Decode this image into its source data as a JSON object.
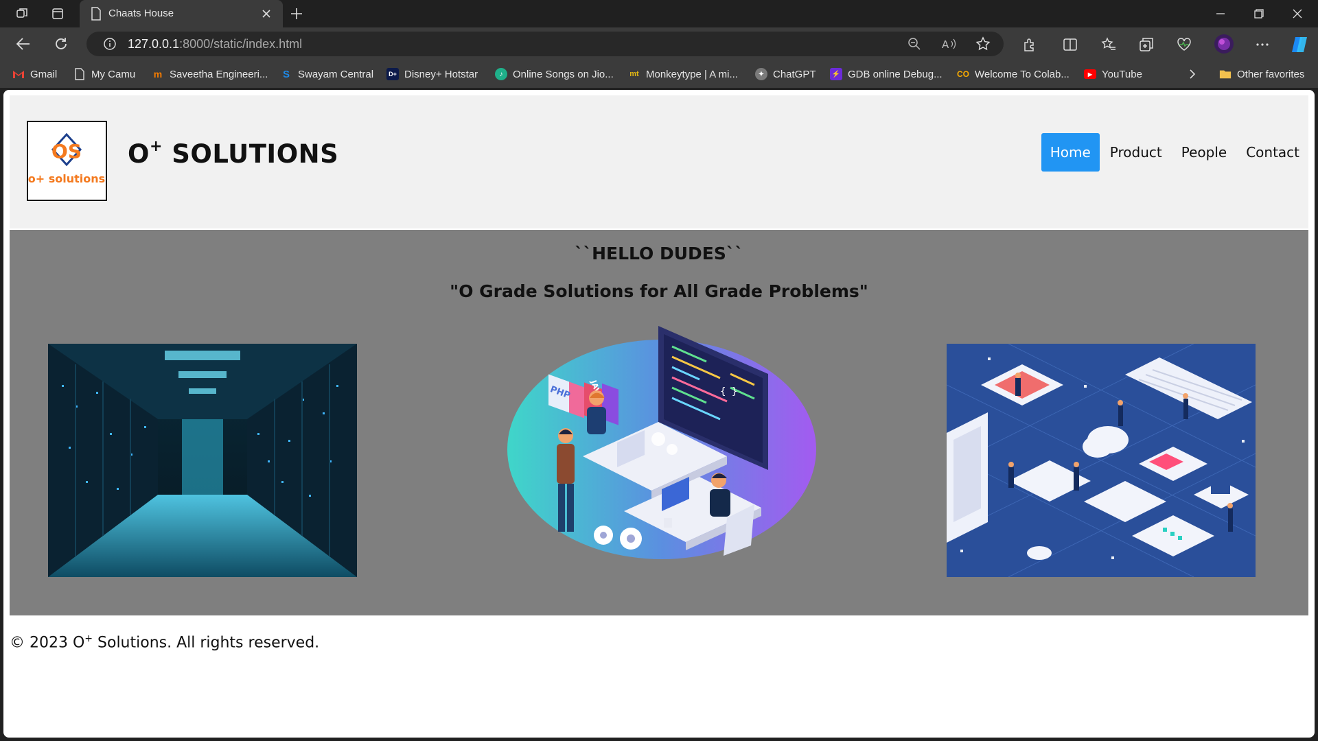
{
  "browser": {
    "tab_title": "Chaats House",
    "url_host": "127.0.0.1",
    "url_rest": ":8000/static/index.html",
    "bookmarks": [
      {
        "label": "Gmail",
        "icon": "gmail-icon",
        "color": "#ea4335"
      },
      {
        "label": "My Camu",
        "icon": "page-icon",
        "color": "#3b3b3b"
      },
      {
        "label": "Saveetha Engineeri...",
        "icon": "saveetha-icon",
        "color": "#f57c00"
      },
      {
        "label": "Swayam Central",
        "icon": "swayam-icon",
        "color": "#1e88e5"
      },
      {
        "label": "Disney+ Hotstar",
        "icon": "hotstar-icon",
        "color": "#0c1a4a"
      },
      {
        "label": "Online Songs on Jio...",
        "icon": "jiosaavn-icon",
        "color": "#1fb08a"
      },
      {
        "label": "Monkeytype | A mi...",
        "icon": "monkeytype-icon",
        "color": "#3b3b3b"
      },
      {
        "label": "ChatGPT",
        "icon": "chatgpt-icon",
        "color": "#7a7a7a"
      },
      {
        "label": "GDB online Debug...",
        "icon": "gdb-icon",
        "color": "#6c2bd9"
      },
      {
        "label": "Welcome To Colab...",
        "icon": "colab-icon",
        "color": "#f9ab00"
      },
      {
        "label": "YouTube",
        "icon": "youtube-icon",
        "color": "#ff0000"
      }
    ],
    "other_favorites": "Other favorites"
  },
  "site": {
    "brand_main": "O",
    "brand_sup": "+",
    "brand_rest": " SOLUTIONS",
    "logo_top": "OS",
    "logo_bottom": "o+ solutions",
    "nav": [
      {
        "label": "Home",
        "active": true
      },
      {
        "label": "Product",
        "active": false
      },
      {
        "label": "People",
        "active": false
      },
      {
        "label": "Contact",
        "active": false
      }
    ],
    "hero_title": "``HELLO DUDES``",
    "hero_tagline": "\"O Grade Solutions for All Grade Problems\"",
    "center_labels": [
      "PHP",
      "JAVA",
      "{ }"
    ],
    "footer_pre": "© 2023 O",
    "footer_sup": "+",
    "footer_post": " Solutions. All rights reserved."
  },
  "colors": {
    "nav_active": "#2195f3",
    "hero_bg": "#7f7f7f",
    "header_bg": "#f1f1f1",
    "right_img_bg": "#2a4f9a"
  }
}
